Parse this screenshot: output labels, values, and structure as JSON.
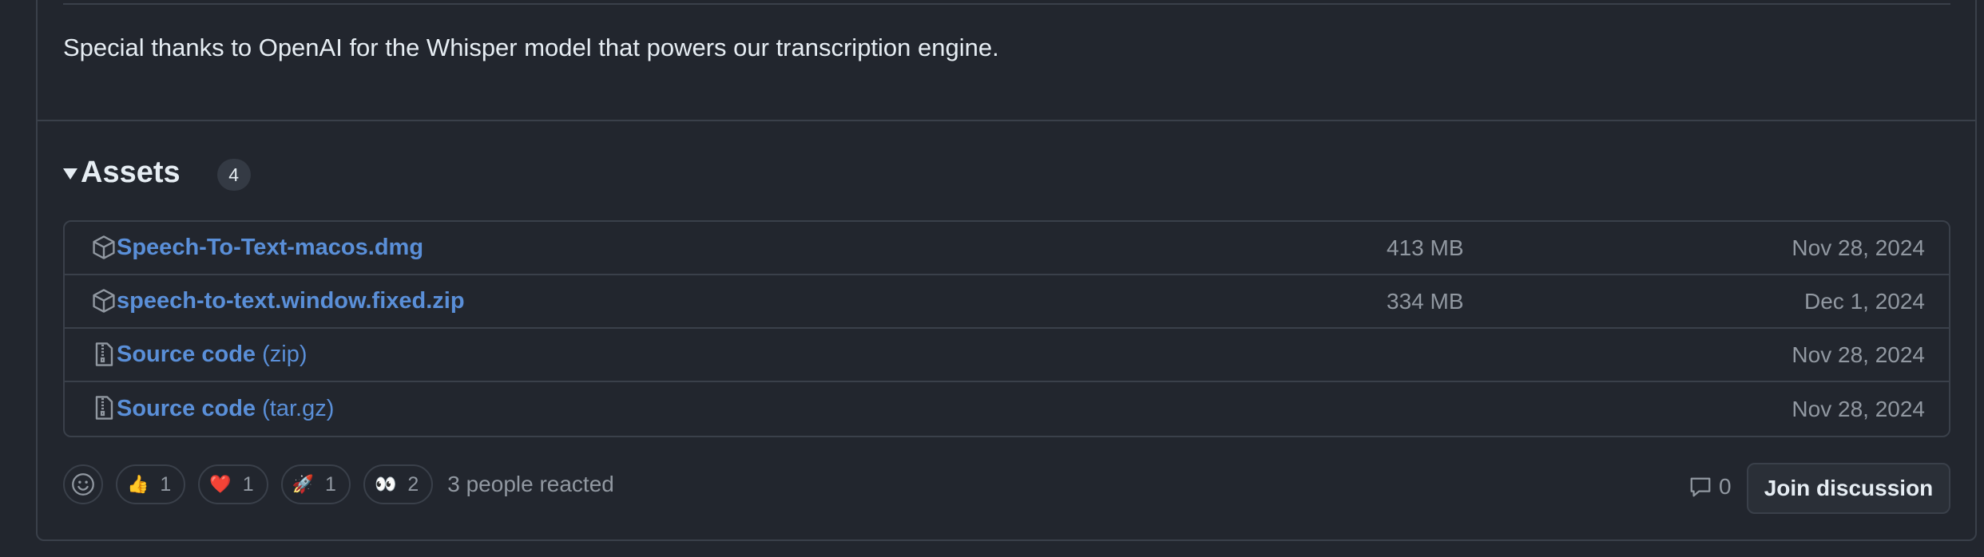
{
  "release": {
    "thanks_text": "Special thanks to OpenAI for the Whisper model that powers our transcription engine."
  },
  "assets": {
    "title": "Assets",
    "count": "4",
    "items": [
      {
        "name": "Speech-To-Text-macos.dmg",
        "suffix": "",
        "size": "413 MB",
        "date": "Nov 28, 2024",
        "icon": "package-icon"
      },
      {
        "name": "speech-to-text.window.fixed.zip",
        "suffix": "",
        "size": "334 MB",
        "date": "Dec 1, 2024",
        "icon": "package-icon"
      },
      {
        "name": "Source code",
        "suffix": "(zip)",
        "size": "",
        "date": "Nov 28, 2024",
        "icon": "file-zip-icon"
      },
      {
        "name": "Source code",
        "suffix": "(tar.gz)",
        "size": "",
        "date": "Nov 28, 2024",
        "icon": "file-zip-icon"
      }
    ]
  },
  "reactions": {
    "items": [
      {
        "emoji": "👍",
        "count": "1",
        "name": "thumbs-up"
      },
      {
        "emoji": "❤️",
        "count": "1",
        "name": "heart"
      },
      {
        "emoji": "🚀",
        "count": "1",
        "name": "rocket"
      },
      {
        "emoji": "👀",
        "count": "2",
        "name": "eyes"
      }
    ],
    "summary": "3 people reacted"
  },
  "discussion": {
    "comment_count": "0",
    "join_label": "Join discussion"
  },
  "colors": {
    "background": "#22262e",
    "border": "#3a404a",
    "link": "#5a8fd8",
    "muted": "#9198a1"
  }
}
